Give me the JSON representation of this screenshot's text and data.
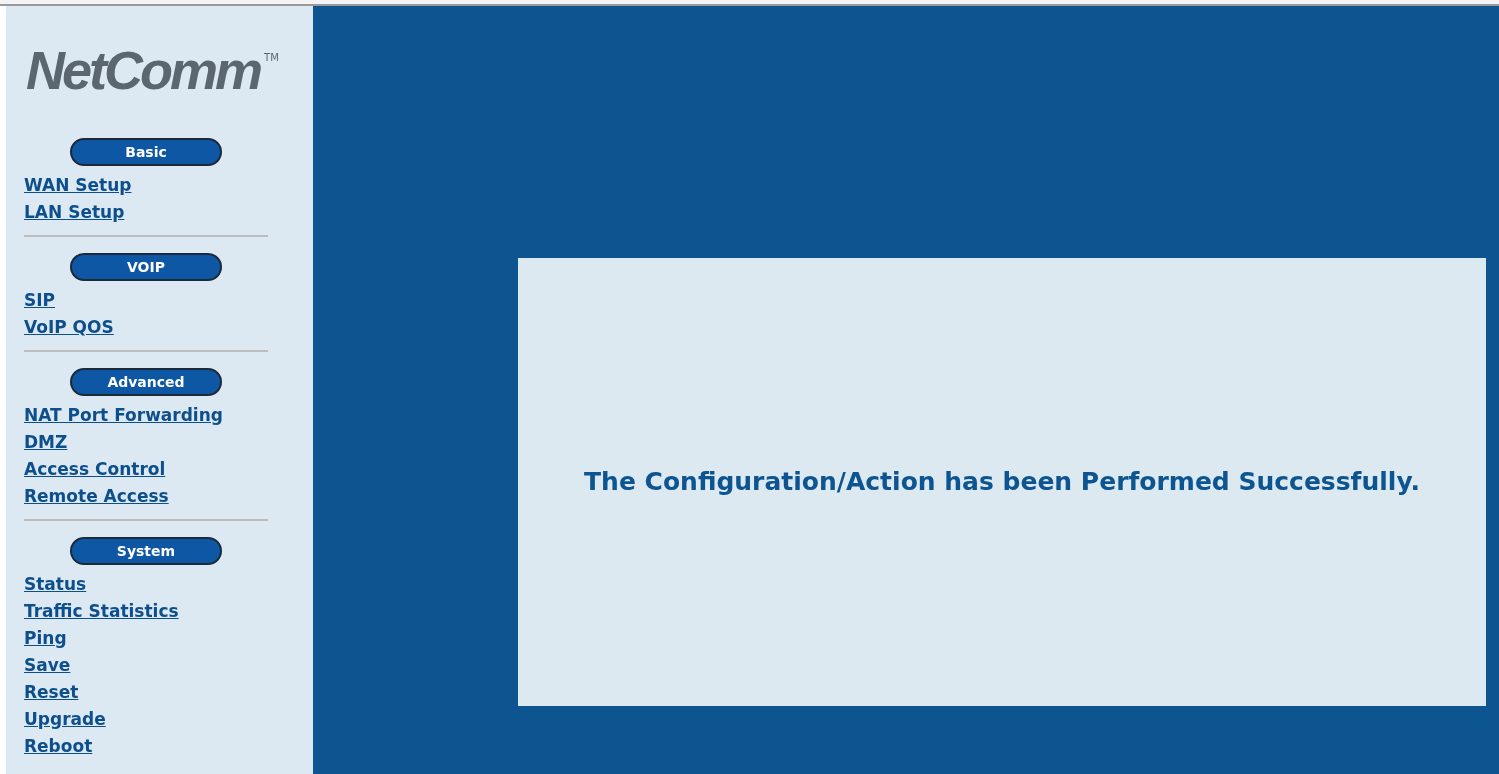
{
  "logo": {
    "text": "NetComm",
    "mark": "TM"
  },
  "sections": [
    {
      "title": "Basic",
      "links": [
        "WAN Setup",
        "LAN Setup"
      ]
    },
    {
      "title": "VOIP",
      "links": [
        "SIP",
        "VoIP QOS"
      ]
    },
    {
      "title": "Advanced",
      "links": [
        "NAT Port Forwarding",
        "DMZ",
        "Access Control",
        "Remote Access"
      ]
    },
    {
      "title": "System",
      "links": [
        "Status",
        "Traffic Statistics",
        "Ping",
        "Save",
        "Reset",
        "Upgrade",
        "Reboot"
      ]
    }
  ],
  "message": "The Configuration/Action has been Performed Successfully."
}
